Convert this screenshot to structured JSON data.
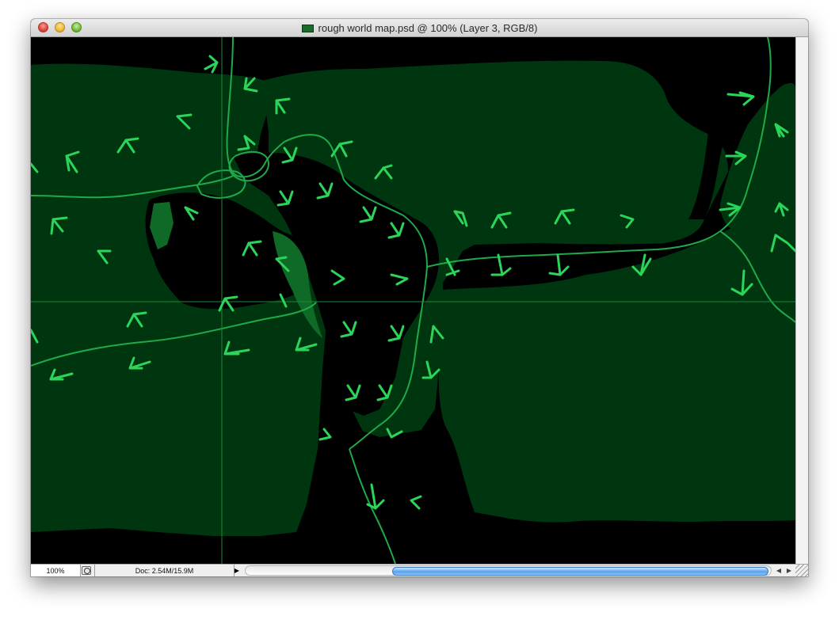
{
  "window": {
    "title": "rough world map.psd @ 100% (Layer 3, RGB/8)"
  },
  "statusbar": {
    "zoom": "100%",
    "doc_info": "Doc: 2.54M/15.9M",
    "scroll_fraction": 0.73
  },
  "icons": {
    "close": "close-button",
    "minimize": "minimize-button",
    "zoom": "zoom-button",
    "document": "document-icon",
    "status": "status-icon",
    "menu": "triangle-right-icon",
    "left_arrow": "scroll-left-icon",
    "right_arrow": "scroll-right-icon"
  },
  "colors": {
    "background": "#000000",
    "land": "#00360f",
    "land_light": "#0e6a26",
    "line": "#1fa94a",
    "arrow": "#2bd55a"
  }
}
